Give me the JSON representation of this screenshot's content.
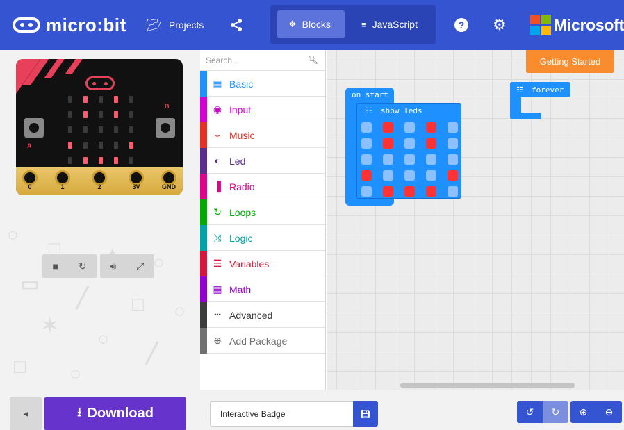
{
  "header": {
    "brand": "micro:bit",
    "projects_label": "Projects",
    "tabs": [
      {
        "label": "Blocks",
        "active": true
      },
      {
        "label": "JavaScript",
        "active": false
      }
    ],
    "microsoft_label": "Microsoft",
    "icons": {
      "projects": "folder-icon",
      "share": "share-icon",
      "help": "help-icon",
      "settings": "gear-icon",
      "blocks": "puzzle-icon",
      "javascript": "code-icon"
    }
  },
  "toolbox": {
    "search_placeholder": "Search...",
    "categories": [
      {
        "label": "Basic",
        "color": "#1e90ff",
        "icon": "grid-icon"
      },
      {
        "label": "Input",
        "color": "#d400d4",
        "icon": "target-icon"
      },
      {
        "label": "Music",
        "color": "#e63022",
        "icon": "headphones-icon"
      },
      {
        "label": "Led",
        "color": "#5c2d91",
        "icon": "toggle-icon"
      },
      {
        "label": "Radio",
        "color": "#e3008c",
        "icon": "signal-icon"
      },
      {
        "label": "Loops",
        "color": "#00aa00",
        "icon": "refresh-icon"
      },
      {
        "label": "Logic",
        "color": "#00a4a6",
        "icon": "shuffle-icon"
      },
      {
        "label": "Variables",
        "color": "#dc143c",
        "icon": "list-icon"
      },
      {
        "label": "Math",
        "color": "#9400d3",
        "icon": "calculator-icon"
      },
      {
        "label": "Advanced",
        "color": "#3c3c3c",
        "icon": "ellipsis-icon"
      },
      {
        "label": "Add Package",
        "color": "#717171",
        "icon": "plus-circle-icon"
      }
    ]
  },
  "workspace": {
    "getting_started_label": "Getting Started",
    "on_start_label": "on start",
    "show_leds_label": "show leds",
    "forever_label": "forever",
    "led_grid": [
      [
        0,
        1,
        0,
        1,
        0
      ],
      [
        0,
        1,
        0,
        1,
        0
      ],
      [
        0,
        0,
        0,
        0,
        0
      ],
      [
        1,
        0,
        0,
        0,
        1
      ],
      [
        0,
        1,
        1,
        1,
        0
      ]
    ],
    "colors": {
      "block": "#1e90ff",
      "led_on": "#ff3333",
      "led_off": "#8cc0ff"
    }
  },
  "simulator": {
    "button_a_label": "A",
    "button_b_label": "B",
    "pins": [
      "0",
      "1",
      "2",
      "3V",
      "GND"
    ],
    "leds_on": [
      [
        0,
        1,
        0,
        1,
        0
      ],
      [
        0,
        1,
        0,
        1,
        0
      ],
      [
        0,
        0,
        0,
        0,
        0
      ],
      [
        1,
        0,
        0,
        0,
        1
      ],
      [
        0,
        1,
        1,
        1,
        0
      ]
    ],
    "controls": [
      "stop-icon",
      "restart-icon",
      "mute-icon",
      "fullscreen-icon"
    ]
  },
  "footer": {
    "download_label": "Download",
    "project_name": "Interactive Badge",
    "icons": {
      "toggle_sim": "collapse-icon",
      "download": "download-icon",
      "save": "save-icon",
      "undo": "undo-icon",
      "redo": "redo-icon",
      "zoom_in": "zoom-in-icon",
      "zoom_out": "zoom-out-icon"
    }
  }
}
